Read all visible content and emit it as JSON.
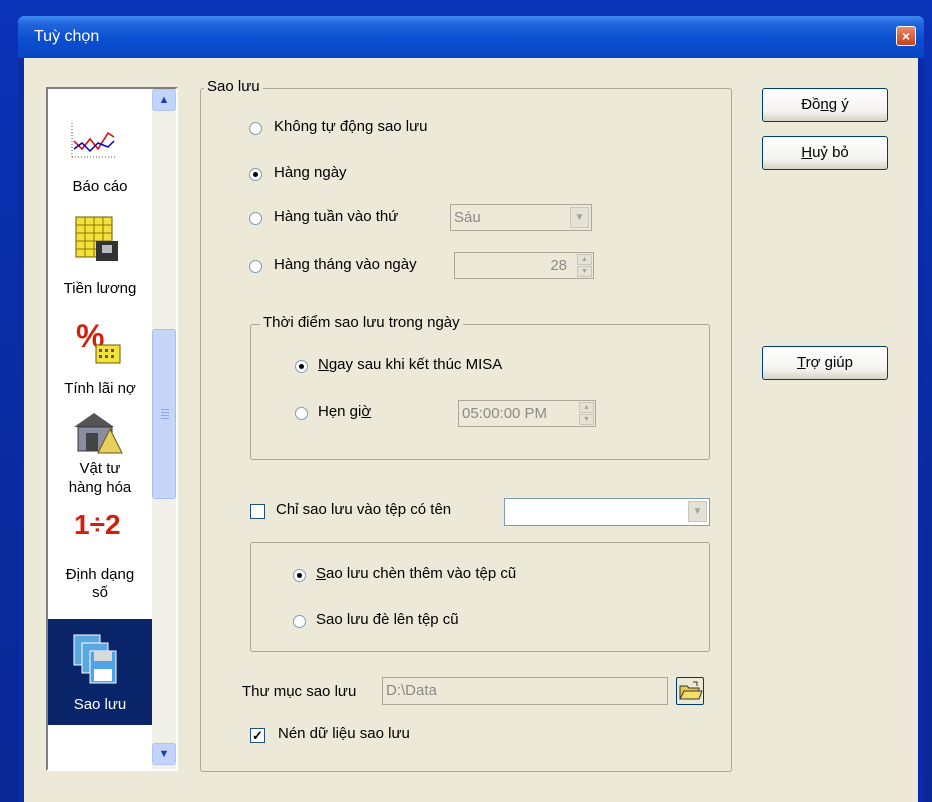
{
  "window": {
    "title": "Tuỳ chọn",
    "close_icon": "close-icon"
  },
  "sidebar": {
    "items": [
      {
        "label": "Báo cáo",
        "icon": "chart-icon"
      },
      {
        "label": "Tiền lương",
        "icon": "payroll-icon"
      },
      {
        "label": "Tính lãi nợ",
        "icon": "percent-icon"
      },
      {
        "label_line1": "Vật tư",
        "label_line2": "hàng hóa",
        "icon": "warehouse-icon"
      },
      {
        "label_line1": "Định dạng",
        "label_line2": "số",
        "icon": "number-format-icon",
        "icon_text": "1÷2"
      },
      {
        "label": "Sao lưu",
        "icon": "floppy-disk-icon",
        "selected": true
      }
    ],
    "scroll_up_glyph": "▲",
    "scroll_down_glyph": "▼"
  },
  "backup": {
    "group_title": "Sao lưu",
    "options": {
      "no_auto": "Không tự động sao lưu",
      "daily": "Hàng ngày",
      "weekly": "Hàng tuần vào thứ",
      "monthly": "Hàng tháng vào ngày"
    },
    "selected_option": "daily",
    "weekday_value": "Sáu",
    "month_day_value": "28",
    "time_group": {
      "title": "Thời điểm sao lưu trong ngày",
      "after_exit_prefix": "N",
      "after_exit_rest": "gay sau khi kết thúc MISA",
      "scheduled_prefix": "Hẹn gi",
      "scheduled_ul": "ờ",
      "time_value": "05:00:00 PM",
      "selected": "after_exit"
    },
    "only_file": {
      "label": "Chỉ sao lưu vào tệp có tên",
      "checked": false,
      "value": ""
    },
    "file_mode": {
      "append_ul": "S",
      "append_rest": "ao lưu chèn thêm vào tệp cũ",
      "overwrite": "Sao lưu đè lên tệp cũ",
      "selected": "append"
    },
    "folder": {
      "label": "Thư mục sao lưu",
      "value": "D:\\Data",
      "browse_icon": "folder-open-icon"
    },
    "compress": {
      "label": "Nén dữ liệu sao lưu",
      "checked": true,
      "check_glyph": "✓"
    }
  },
  "buttons": {
    "ok_pre": "Đồ",
    "ok_ul": "n",
    "ok_post": "g ý",
    "cancel_ul": "H",
    "cancel_post": "uỷ bỏ",
    "help_ul": "T",
    "help_post": "rợ giúp"
  },
  "colors": {
    "title_bar": "#0a4fd0",
    "dialog_face": "#ece9d8",
    "selection": "#0a246a",
    "close_button": "#c8401c"
  }
}
